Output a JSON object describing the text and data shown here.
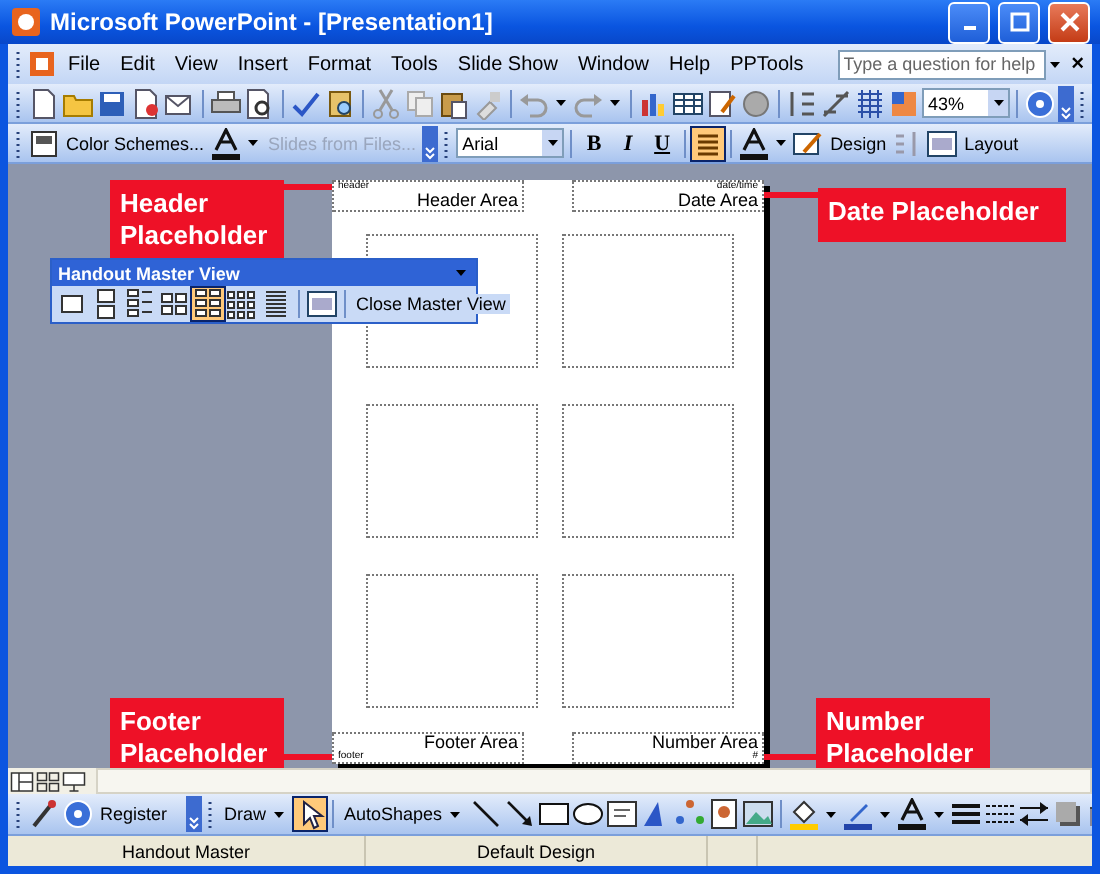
{
  "window": {
    "title": "Microsoft PowerPoint - [Presentation1]"
  },
  "menu": [
    "File",
    "Edit",
    "View",
    "Insert",
    "Format",
    "Tools",
    "Slide Show",
    "Window",
    "Help",
    "PPTools"
  ],
  "help_box": {
    "placeholder": "Type a question for help"
  },
  "menu_close": "×",
  "standard_toolbar": {
    "zoom": "43%"
  },
  "formatting_toolbar": {
    "color_schemes": "Color Schemes...",
    "slides_from_files": {
      "label": "Slides from Files...",
      "disabled": true
    },
    "font": "Arial",
    "bold": "B",
    "italic": "I",
    "underline": "U",
    "align_button": {
      "selected": true
    },
    "design": "Design",
    "layout": "Layout"
  },
  "handout_toolbar": {
    "title": "Handout Master View",
    "layouts": [
      {
        "selected": false
      },
      {
        "selected": false
      },
      {
        "selected": false
      },
      {
        "selected": false
      },
      {
        "selected": true
      },
      {
        "selected": false
      },
      {
        "selected": false
      }
    ],
    "close": "Close Master View"
  },
  "handout_page": {
    "header": {
      "tag": "header",
      "label": "Header Area"
    },
    "date": {
      "tag": "date/time",
      "label": "Date Area"
    },
    "footer": {
      "tag": "footer",
      "label": "Footer Area"
    },
    "number": {
      "tag": "#",
      "label": "Number Area"
    }
  },
  "callouts": [
    {
      "text": "Header Placeholder"
    },
    {
      "text": "Date Placeholder"
    },
    {
      "text": "Footer Placeholder"
    },
    {
      "text": "Number Placeholder"
    }
  ],
  "drawing_toolbar": {
    "register": "Register",
    "draw": "Draw",
    "select_tool": {
      "selected": true
    },
    "autoshapes": "AutoShapes"
  },
  "status_bar": [
    "Handout Master",
    "Default Design"
  ]
}
